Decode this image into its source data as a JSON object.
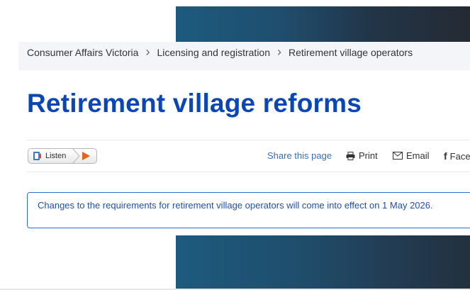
{
  "breadcrumb": {
    "items": [
      "Consumer Affairs Victoria",
      "Licensing and registration",
      "Retirement village operators"
    ]
  },
  "page": {
    "title": "Retirement village reforms"
  },
  "toolbar": {
    "listen_label": "Listen",
    "share_label": "Share this page",
    "print_label": "Print",
    "email_label": "Email",
    "facebook_label": "Face"
  },
  "alert": {
    "text": "Changes to the requirements for retirement village operators will come into effect on 1 May 2026."
  },
  "colors": {
    "title": "#0a46b5",
    "link": "#3a6fb0",
    "alert_border": "#2a6fd6",
    "play": "#e0661b"
  },
  "icons": [
    "chevron-right-icon",
    "speaker-icon",
    "play-icon",
    "printer-icon",
    "envelope-icon",
    "facebook-icon"
  ]
}
